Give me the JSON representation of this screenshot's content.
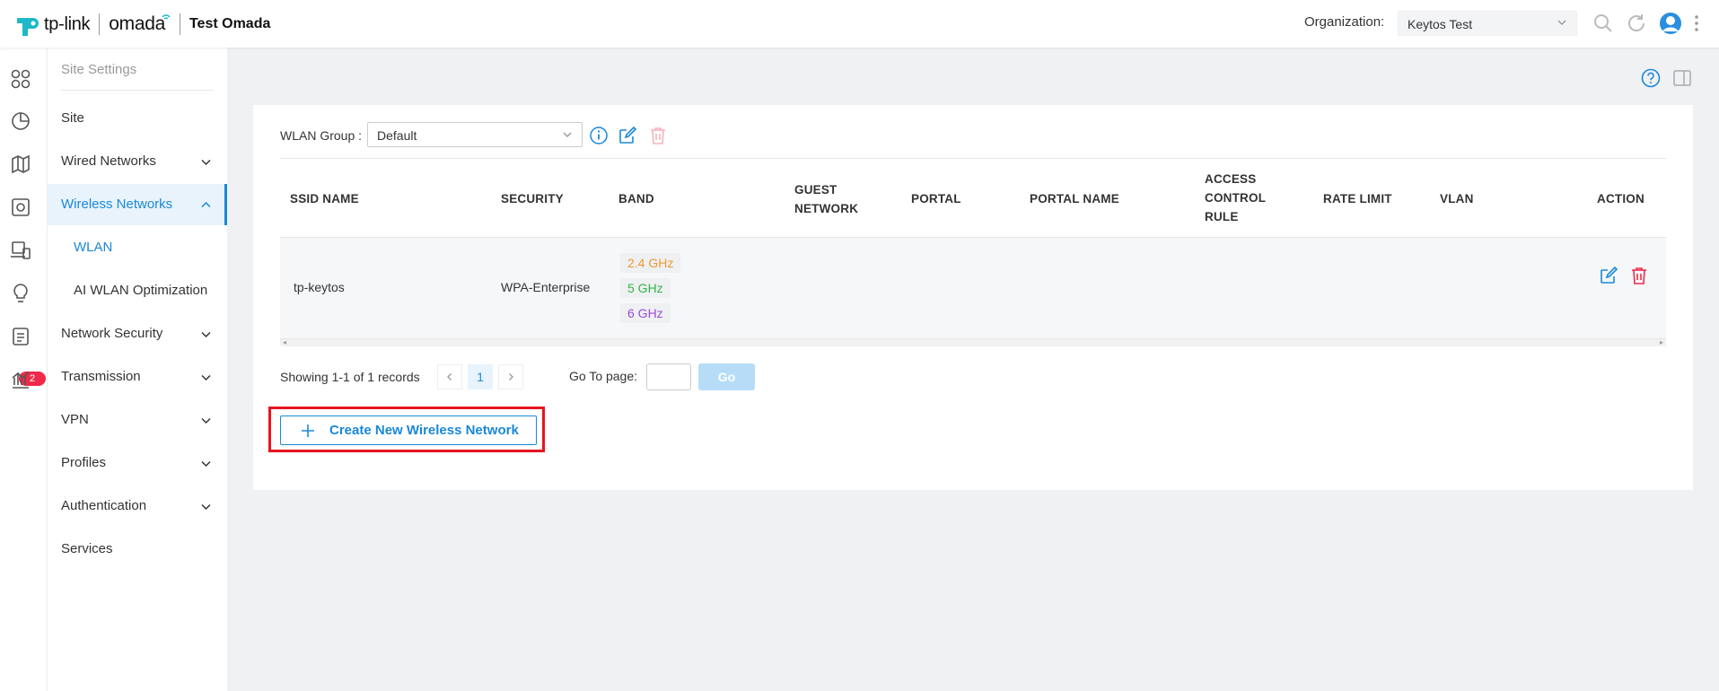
{
  "header": {
    "brand": "tp-link",
    "product": "omada",
    "site_name": "Test Omada",
    "organization_label": "Organization:",
    "organization_value": "Keytos Test"
  },
  "rail": {
    "notification_count": "2"
  },
  "sidebar": {
    "title": "Site Settings",
    "items": [
      {
        "label": "Site"
      },
      {
        "label": "Wired Networks"
      },
      {
        "label": "Wireless Networks"
      },
      {
        "label": "WLAN"
      },
      {
        "label": "AI WLAN Optimization"
      },
      {
        "label": "Network Security"
      },
      {
        "label": "Transmission"
      },
      {
        "label": "VPN"
      },
      {
        "label": "Profiles"
      },
      {
        "label": "Authentication"
      },
      {
        "label": "Services"
      }
    ]
  },
  "wlan_group": {
    "label": "WLAN Group :",
    "selected": "Default"
  },
  "table": {
    "columns": [
      "SSID NAME",
      "SECURITY",
      "BAND",
      "GUEST NETWORK",
      "PORTAL",
      "PORTAL NAME",
      "ACCESS CONTROL RULE",
      "RATE LIMIT",
      "VLAN",
      "ACTION"
    ],
    "rows": [
      {
        "ssid": "tp-keytos",
        "security": "WPA-Enterprise",
        "bands": [
          "2.4 GHz",
          "5 GHz",
          "6 GHz"
        ]
      }
    ]
  },
  "band_colors": {
    "band_24": "#f0982f",
    "band_5": "#35b34a",
    "band_6": "#9b4dd9"
  },
  "pagination": {
    "showing": "Showing 1-1 of 1 records",
    "current_page": "1",
    "goto_label": "Go To page:",
    "go_label": "Go"
  },
  "create_button": {
    "label": "Create New Wireless Network"
  },
  "colors": {
    "accent": "#1a88d8",
    "danger": "#ef2a4a",
    "highlight": "#e8141f"
  }
}
